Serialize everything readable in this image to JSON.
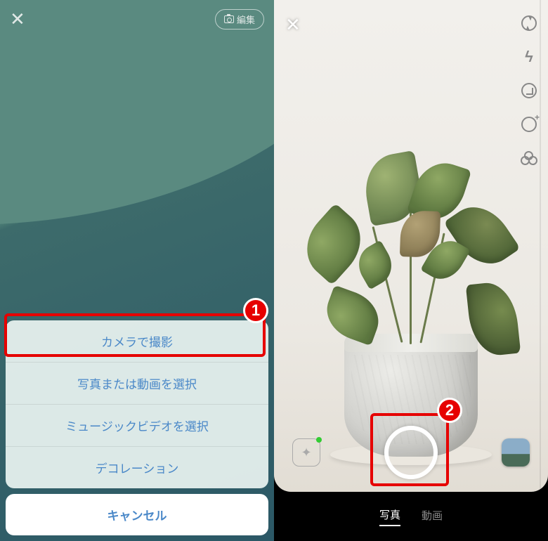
{
  "left": {
    "edit_label": "編集",
    "menu": [
      "カメラで撮影",
      "写真または動画を選択",
      "ミュージックビデオを選択",
      "デコレーション"
    ],
    "cancel": "キャンセル",
    "highlight_index": 0,
    "badge": "1"
  },
  "right": {
    "modes": {
      "photo": "写真",
      "video": "動画",
      "active": "photo"
    },
    "badge": "2"
  }
}
